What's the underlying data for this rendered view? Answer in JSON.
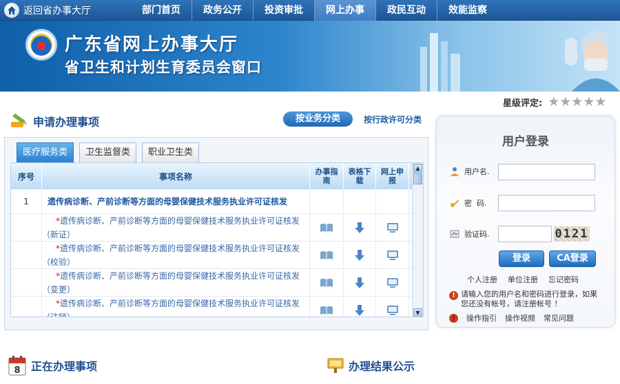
{
  "topbar": {
    "home_label": "返回省办事大厅",
    "nav": [
      "部门首页",
      "政务公开",
      "投资审批",
      "网上办事",
      "政民互动",
      "效能监察"
    ],
    "active_index": 3
  },
  "banner": {
    "title": "广东省网上办事大厅",
    "subtitle": "省卫生和计划生育委员会窗口"
  },
  "rating": {
    "label": "星级评定:",
    "stars": 5
  },
  "apply": {
    "title": "申请办理事项",
    "btn_business": "按业务分类",
    "link_admin": "按行政许可分类",
    "tabs": [
      "医疗服务类",
      "卫生监督类",
      "职业卫生类"
    ],
    "active_tab": 0,
    "columns": {
      "no": "序号",
      "name": "事项名称",
      "guide": "办事指南",
      "form": "表格下载",
      "online": "网上申报"
    },
    "main_item": {
      "no": "1",
      "name": "遗传病诊断、产前诊断等方面的母婴保健技术服务执业许可证核发"
    },
    "sub_items": [
      {
        "name": "遗传病诊断、产前诊断等方面的母婴保健技术服务执业许可证核发（新证）"
      },
      {
        "name": "遗传病诊断、产前诊断等方面的母婴保健技术服务执业许可证核发（校验）"
      },
      {
        "name": "遗传病诊断、产前诊断等方面的母婴保健技术服务执业许可证核发（变更）"
      },
      {
        "name": "遗传病诊断、产前诊断等方面的母婴保健技术服务执业许可证核发（注销）"
      }
    ],
    "required_mark": "*"
  },
  "login": {
    "title": "用户登录",
    "username_label": "用户名.",
    "password_label": "密  码.",
    "captcha_label": "验证码.",
    "captcha_value": "0121",
    "login_btn": "登录",
    "ca_btn": "CA登录",
    "links": [
      "个人注册",
      "单位注册",
      "忘记密码"
    ],
    "notice": "请输入您的用户名和密码进行登录，如果您还没有帐号，请注册帐号 ！",
    "help_links": [
      "操作指引",
      "操作视频",
      "常见问题"
    ]
  },
  "processing": {
    "title": "正在办理事项"
  },
  "results": {
    "title": "办理结果公示"
  },
  "colors": {
    "primary": "#2a6fb8",
    "nav_bg": "#1d5796",
    "accent_red": "#d11111"
  }
}
